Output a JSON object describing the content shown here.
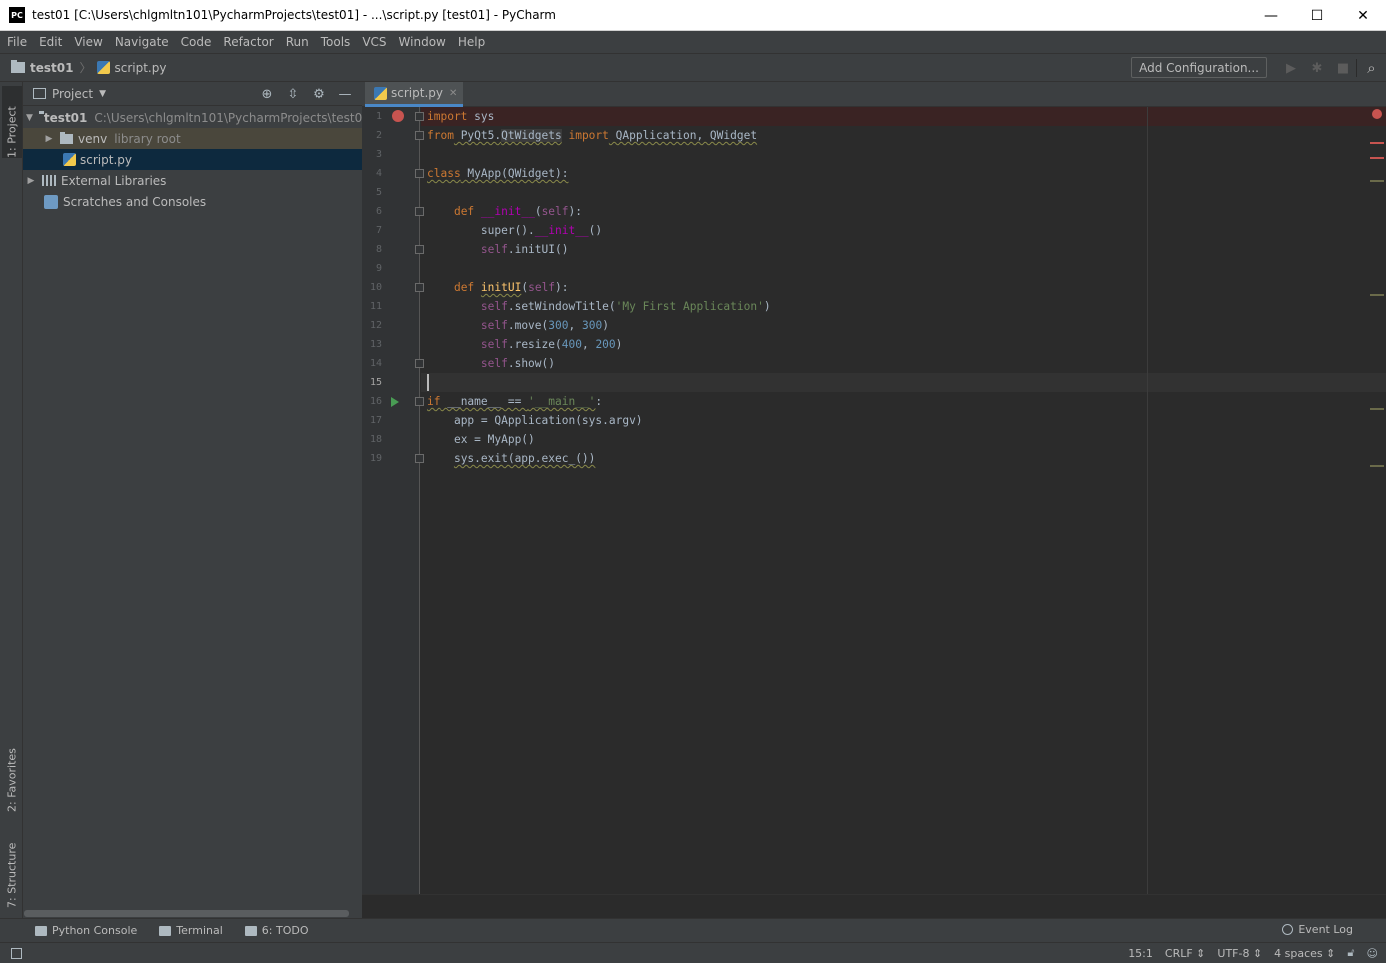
{
  "window": {
    "logo_text": "PC",
    "title": "test01 [C:\\Users\\chlgmltn101\\PycharmProjects\\test01] - ...\\script.py [test01] - PyCharm",
    "minimize": "—",
    "maximize": "☐",
    "close": "✕"
  },
  "menu": [
    "File",
    "Edit",
    "View",
    "Navigate",
    "Code",
    "Refactor",
    "Run",
    "Tools",
    "VCS",
    "Window",
    "Help"
  ],
  "navbar": {
    "project": "test01",
    "file": "script.py",
    "add_config": "Add Configuration..."
  },
  "left_stripe": {
    "project_tab": "1: Project",
    "favorites_tab": "2: Favorites",
    "structure_tab": "7: Structure"
  },
  "project_panel": {
    "title": "Project",
    "tree": {
      "root_name": "test01",
      "root_path": "C:\\Users\\chlgmltn101\\PycharmProjects\\test01",
      "venv": "venv",
      "venv_note": "library root",
      "script": "script.py",
      "ext_libs": "External Libraries",
      "scratches": "Scratches and Consoles"
    }
  },
  "editor": {
    "tab_label": "script.py",
    "line_numbers": [
      "1",
      "2",
      "3",
      "4",
      "5",
      "6",
      "7",
      "8",
      "9",
      "10",
      "11",
      "12",
      "13",
      "14",
      "15",
      "16",
      "17",
      "18",
      "19"
    ],
    "code": {
      "l1_kw": "import",
      "l1_rest": " sys",
      "l2_kw": "from",
      "l2_mod": " PyQt5.",
      "l2_sub": "QtWidgets",
      "l2_imp": " import",
      "l2_names": " QApplication, QWidget",
      "l4_kw": "class",
      "l4_rest": " MyApp(QWidget):",
      "l6_def": "def",
      "l6_name": "__init__",
      "l6_self": "self",
      "l7_call": "super().",
      "l7_init": "__init__",
      "l7_tail": "()",
      "l8_self": "self",
      "l8_rest": ".initUI()",
      "l10_def": "def",
      "l10_name": "initUI",
      "l10_self": "self",
      "l11_self": "self",
      "l11_call": ".setWindowTitle(",
      "l11_str": "'My First Application'",
      "l12_self": "self",
      "l12_call": ".move(",
      "l12_n1": "300",
      "l12_n2": "300",
      "l13_self": "self",
      "l13_call": ".resize(",
      "l13_n1": "400",
      "l13_n2": "200",
      "l14_self": "self",
      "l14_rest": ".show()",
      "l16_if": "if",
      "l16_name": " __name__ == ",
      "l16_str": "'__main__'",
      "l16_colon": ":",
      "l17": "app = QApplication(sys.argv)",
      "l18": "ex = MyApp()",
      "l19": "sys.exit(app.exec_())"
    }
  },
  "tool_windows": {
    "python_console": "Python Console",
    "terminal": "Terminal",
    "todo": "6: TODO",
    "event_log": "Event Log"
  },
  "status": {
    "position": "15:1",
    "line_sep": "CRLF ⇕",
    "encoding": "UTF-8 ⇕",
    "indent": "4 spaces ⇕"
  },
  "colors": {
    "bg_editor": "#2b2b2b",
    "bg_panel": "#3c3f41",
    "keyword": "#cc7832",
    "self": "#94558d",
    "number": "#6897bb",
    "string": "#6a8759",
    "breakpoint": "#c75450",
    "run_marker": "#499c54"
  },
  "icons": {
    "search": "search-icon",
    "settings": "gear-icon",
    "locate": "crosshair-icon",
    "collapse": "collapse-icon",
    "hide": "minimize-icon",
    "run": "play-icon",
    "debug": "bug-icon",
    "stop": "stop-icon"
  }
}
